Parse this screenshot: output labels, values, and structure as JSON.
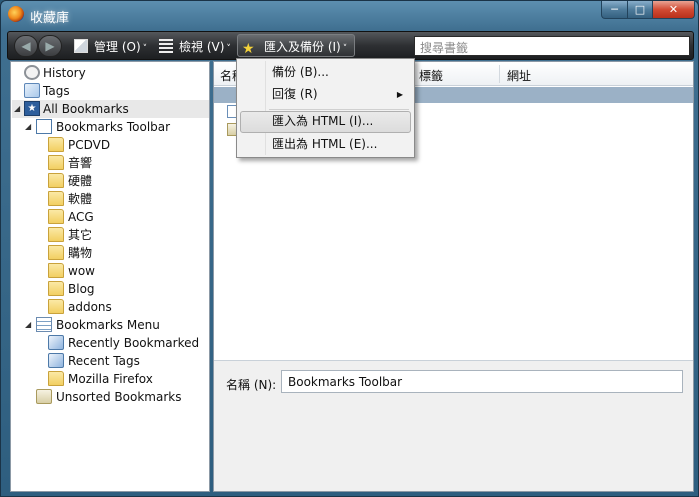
{
  "window": {
    "title": "收藏庫",
    "controls": {
      "minimize": "─",
      "maximize": "□",
      "close": "✕"
    }
  },
  "toolbar": {
    "back_icon": "back-arrow-icon",
    "forward_icon": "forward-arrow-icon",
    "organize_label": "管理 (O)",
    "views_label": "檢視 (V)",
    "import_label": "匯入及備份 (I)",
    "dropdown_marker": "˅",
    "search_placeholder": "搜尋書籤"
  },
  "tree": [
    {
      "label": "History",
      "icon": "history-icon",
      "twisty": ""
    },
    {
      "label": "Tags",
      "icon": "tags-icon",
      "twisty": ""
    },
    {
      "label": "All Bookmarks",
      "icon": "star-icon",
      "twisty": "◢",
      "selected": true
    },
    {
      "label": "Bookmarks Toolbar",
      "icon": "toolbar-icon",
      "twisty": "◢"
    },
    {
      "label": "PCDVD",
      "icon": "folder-icon"
    },
    {
      "label": "音響",
      "icon": "folder-icon"
    },
    {
      "label": "硬體",
      "icon": "folder-icon"
    },
    {
      "label": "軟體",
      "icon": "folder-icon"
    },
    {
      "label": "ACG",
      "icon": "folder-icon"
    },
    {
      "label": "其它",
      "icon": "folder-icon"
    },
    {
      "label": "購物",
      "icon": "folder-icon"
    },
    {
      "label": "wow",
      "icon": "folder-icon"
    },
    {
      "label": "Blog",
      "icon": "folder-icon"
    },
    {
      "label": "addons",
      "icon": "folder-icon"
    },
    {
      "label": "Bookmarks Menu",
      "icon": "menu-icon",
      "twisty": "◢"
    },
    {
      "label": "Recently Bookmarked",
      "icon": "smart-folder-icon"
    },
    {
      "label": "Recent Tags",
      "icon": "smart-folder-icon"
    },
    {
      "label": "Mozilla Firefox",
      "icon": "folder-icon"
    },
    {
      "label": "Unsorted Bookmarks",
      "icon": "unsorted-icon"
    }
  ],
  "columns": {
    "name": "名稱",
    "tags": "標籤",
    "location": "網址"
  },
  "details": {
    "name_label": "名稱 (N):",
    "name_value": "Bookmarks Toolbar"
  },
  "menu": {
    "items": [
      {
        "label": "備份 (B)...",
        "has_submenu": false
      },
      {
        "label": "回復 (R)",
        "has_submenu": true
      },
      {
        "label": "匯入為 HTML (I)...",
        "hover": true
      },
      {
        "label": "匯出為 HTML (E)...",
        "hover": false
      }
    ],
    "submenu_arrow": "▶"
  },
  "colors": {
    "selection": "#9bb1c6",
    "toolbar": "#2e3033",
    "title_bar": "#3f6f90"
  }
}
